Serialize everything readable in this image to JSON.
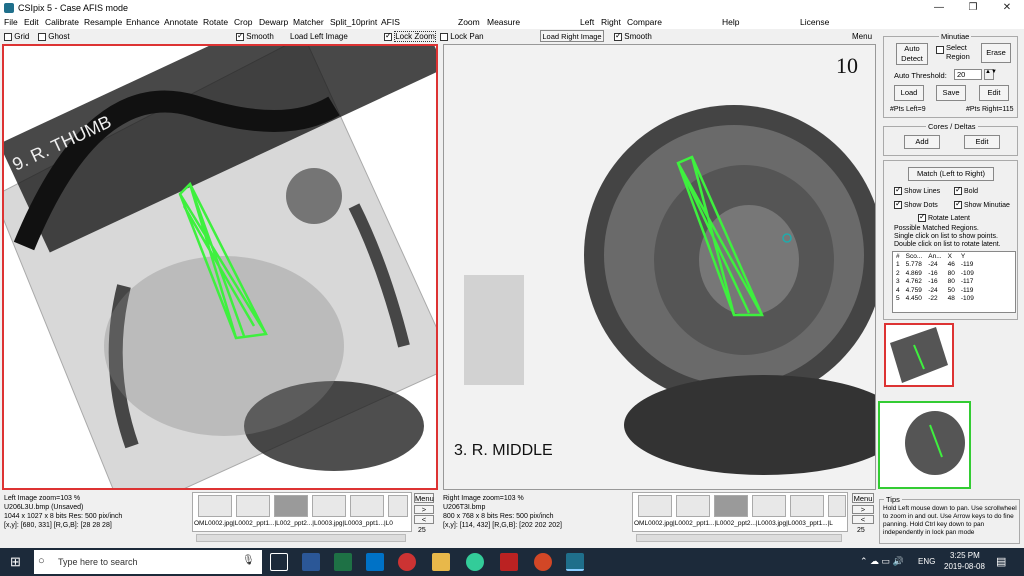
{
  "window": {
    "title": "CSIpix 5 - Case AFIS mode",
    "minimize": "—",
    "maximize": "❐",
    "close": "✕"
  },
  "menu": [
    "File",
    "Edit",
    "Calibrate",
    "Resample",
    "Enhance",
    "Annotate",
    "Rotate",
    "Crop",
    "Dewarp",
    "Matcher",
    "Split_10print",
    "AFIS",
    "Zoom",
    "Measure",
    "Left",
    "Right",
    "Compare",
    "Help",
    "License"
  ],
  "toolbar": {
    "grid": "Grid",
    "ghost": "Ghost",
    "smooth_left": "Smooth",
    "load_left": "Load Left Image",
    "lock_zoom": "Lock Zoom",
    "lock_pan": "Lock Pan",
    "load_right": "Load Right Image",
    "smooth_right": "Smooth",
    "menu": "Menu"
  },
  "images": {
    "left_label": "9. R. THUMB",
    "right_label": "3. R. MIDDLE",
    "right_corner": "10"
  },
  "minutiae": {
    "title": "Minutiae",
    "auto_detect": "Auto\nDetect",
    "select_region": "Select\nRegion",
    "erase": "Erase",
    "auto_threshold_label": "Auto Threshold:",
    "auto_threshold_value": "20",
    "load": "Load",
    "save": "Save",
    "edit": "Edit",
    "pts_left": "#Pts Left=9",
    "pts_right": "#Pts Right=115"
  },
  "cores": {
    "title": "Cores / Deltas",
    "add": "Add",
    "edit": "Edit"
  },
  "match": {
    "button": "Match (Left to Right)",
    "show_lines": "Show Lines",
    "bold": "Bold",
    "show_dots": "Show Dots",
    "show_minutiae": "Show Minutiae",
    "rotate_latent": "Rotate Latent",
    "info1": "Possible Matched Regions.",
    "info2": "Single click on list to show points.",
    "info3": "Double click on list to rotate latent.",
    "columns": [
      "#",
      "Sco...",
      "An...",
      "X",
      "Y"
    ],
    "rows": [
      [
        "1",
        "5.778",
        "-24",
        "46",
        "-119"
      ],
      [
        "2",
        "4.869",
        "-16",
        "80",
        "-109"
      ],
      [
        "3",
        "4.762",
        "-16",
        "80",
        "-117"
      ],
      [
        "4",
        "4.759",
        "-24",
        "50",
        "-119"
      ],
      [
        "5",
        "4.450",
        "-22",
        "48",
        "-109"
      ]
    ]
  },
  "left_status": {
    "title": "Left Image  zoom=103 %",
    "file": "U206L3U.bmp  (Unsaved)",
    "dims": "1044 x 1027 x 8 bits     Res: 500 pix/inch",
    "coords": "[x,y]: [680, 331]     [R,G,B]: [28 28 28]"
  },
  "right_status": {
    "title": "Right Image  zoom=103 %",
    "file": "U206T3I.bmp",
    "dims": "800 x 768 x 8 bits     Res: 500 pix/inch",
    "coords": "[x,y]: [114, 432]     [R,G,B]: [202 202 202]"
  },
  "left_strip": {
    "names": "OML0002.jpg|L0002_ppt1...|L002_ppt2...|L0003.jpg|L0003_ppt1...|L0",
    "menu": "Menu",
    "count": "25"
  },
  "right_strip": {
    "names": "OML0002.jpg|L0002_ppt1...|L0002_ppt2...|L0003.jpg|L0003_ppt1...|L",
    "menu": "Menu",
    "count": "25"
  },
  "tips": {
    "title": "Tips",
    "text": "Hold Left mouse down to pan.  Use scrollwheel to zoom in and out.  Use Arrow keys to do fine panning. Hold Ctrl key down to pan independently in lock pan mode"
  },
  "taskbar": {
    "search": "Type here to search",
    "time": "3:25 PM",
    "date": "2019-08-08",
    "lang": "ENG"
  }
}
